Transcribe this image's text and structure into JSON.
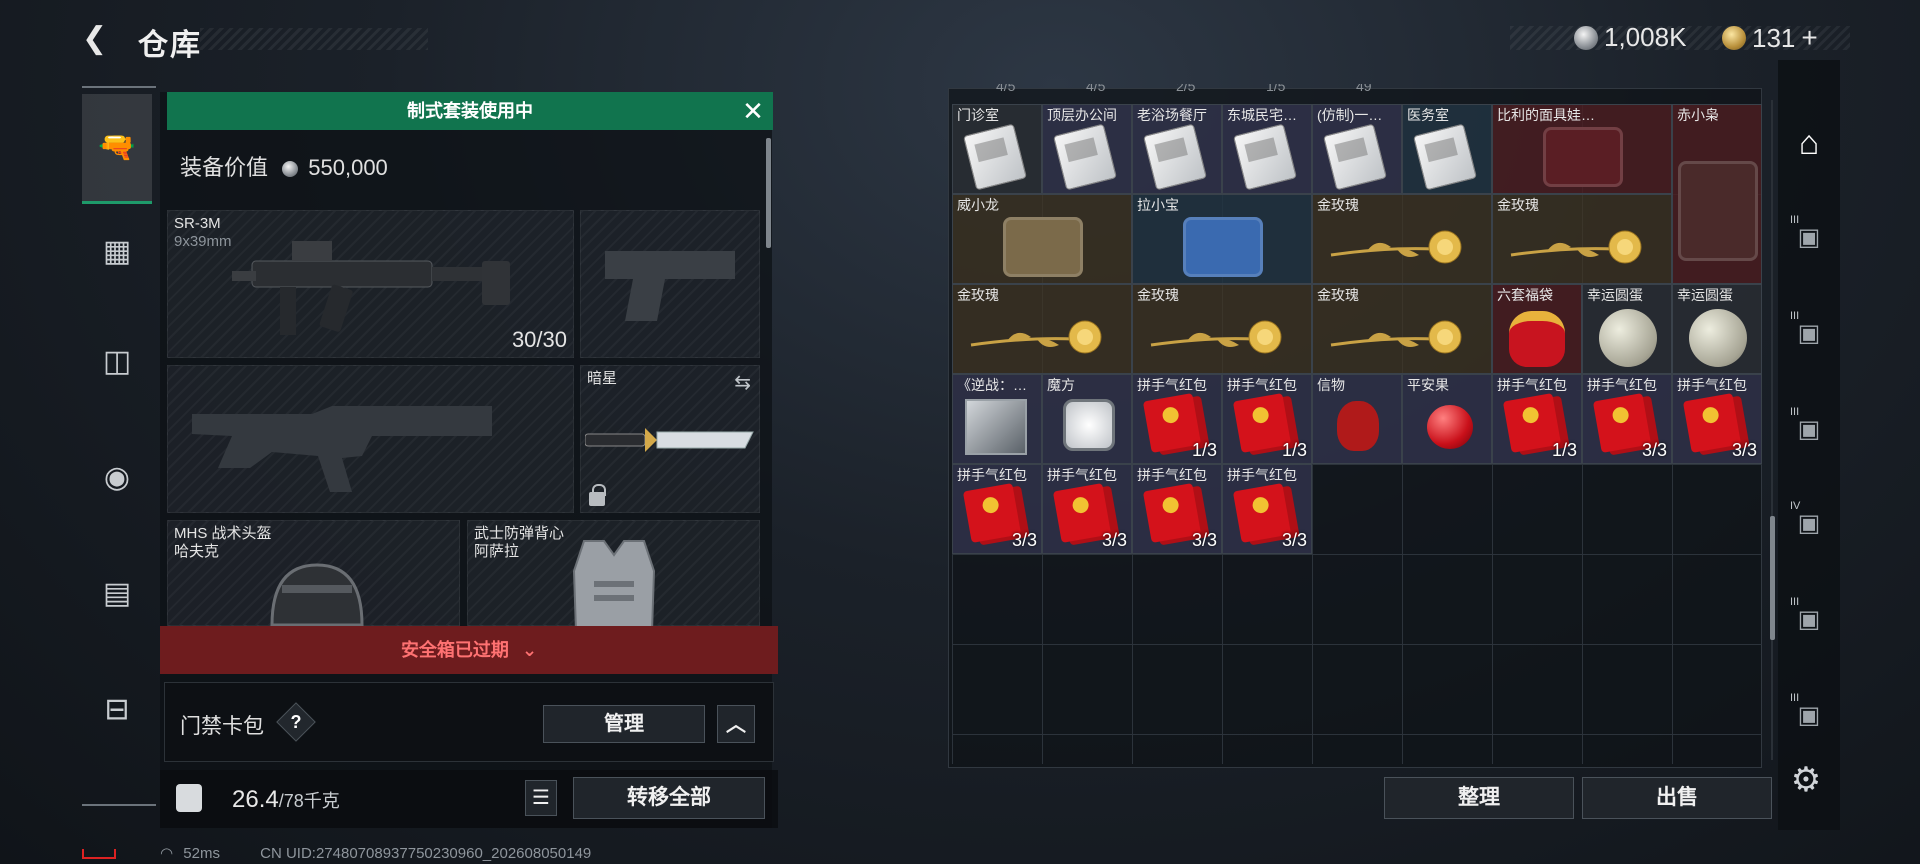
{
  "header": {
    "back_icon": "arrow-left-icon",
    "title": "仓库",
    "currencies": [
      {
        "icon": "silver-coin-icon",
        "value": "1,008K"
      },
      {
        "icon": "gold-coin-icon",
        "value": "131"
      }
    ],
    "add_symbol": "+"
  },
  "left_nav": [
    {
      "icon": "pistol-icon",
      "active": true
    },
    {
      "icon": "armor-vest-icon",
      "active": false
    },
    {
      "icon": "backpack-icon",
      "active": false
    },
    {
      "icon": "helmet-bag-icon",
      "active": false
    },
    {
      "icon": "clipboard-icon",
      "active": false
    },
    {
      "icon": "toolbox-icon",
      "active": false
    }
  ],
  "loadout": {
    "banner": "制式套装使用中",
    "equip_value_label": "装备价值",
    "equip_value": "550,000",
    "primary": {
      "name": "SR-3M",
      "ammo": "9x39mm",
      "count": "30/30"
    },
    "melee": {
      "name": "暗星"
    },
    "helmet": {
      "name": "MHS 战术头盔",
      "sub": "哈夫克"
    },
    "vest": {
      "name": "武士防弹背心",
      "sub": "阿萨拉"
    },
    "safe_box_status": "安全箱已过期",
    "card_pack_label": "门禁卡包",
    "help_symbol": "?",
    "manage_label": "管理",
    "collapse_symbol": "︿",
    "weight_value": "26.4",
    "weight_max": "/78千克",
    "list_icon": "list-icon",
    "transfer_all_label": "转移全部"
  },
  "status": {
    "ping": "52ms",
    "uid": "CN UID:274807089377502309​60_202608050149"
  },
  "stash": {
    "peek_counts": [
      "4/5",
      "4/5",
      "2/5",
      "1/5",
      "49"
    ],
    "items": [
      {
        "name": "门诊室",
        "kind": "keycard",
        "count": ""
      },
      {
        "name": "顶层办公间",
        "kind": "keycard",
        "count": ""
      },
      {
        "name": "老浴场餐厅",
        "kind": "keycard",
        "count": ""
      },
      {
        "name": "东城民宅…",
        "kind": "keycard",
        "count": ""
      },
      {
        "name": "(仿制)一…",
        "kind": "keycard",
        "count": ""
      },
      {
        "name": "医务室",
        "kind": "keycard",
        "count": ""
      },
      {
        "name": "比利的面具娃…",
        "kind": "figure",
        "count": ""
      },
      {
        "name": "赤小枭",
        "kind": "figure",
        "count": ""
      },
      {
        "name": "威小龙",
        "kind": "figure",
        "count": ""
      },
      {
        "name": "拉小宝",
        "kind": "figure",
        "count": ""
      },
      {
        "name": "金玫瑰",
        "kind": "rose",
        "count": ""
      },
      {
        "name": "金玫瑰",
        "kind": "rose",
        "count": ""
      },
      {
        "name": "金玫瑰",
        "kind": "rose",
        "count": ""
      },
      {
        "name": "金玫瑰",
        "kind": "rose",
        "count": ""
      },
      {
        "name": "金玫瑰",
        "kind": "rose",
        "count": ""
      },
      {
        "name": "六套福袋",
        "kind": "bag",
        "count": ""
      },
      {
        "name": "幸运圆蛋",
        "kind": "moon",
        "count": ""
      },
      {
        "name": "幸运圆蛋",
        "kind": "moon",
        "count": ""
      },
      {
        "name": "《逆战：…",
        "kind": "box",
        "count": ""
      },
      {
        "name": "魔方",
        "kind": "cube",
        "count": ""
      },
      {
        "name": "拼手气红包",
        "kind": "envelope",
        "count": "1/3"
      },
      {
        "name": "拼手气红包",
        "kind": "envelope",
        "count": "1/3"
      },
      {
        "name": "信物",
        "kind": "mask",
        "count": ""
      },
      {
        "name": "平安果",
        "kind": "apple",
        "count": ""
      },
      {
        "name": "拼手气红包",
        "kind": "envelope",
        "count": "1/3"
      },
      {
        "name": "拼手气红包",
        "kind": "envelope",
        "count": "3/3"
      },
      {
        "name": "拼手气红包",
        "kind": "envelope",
        "count": "3/3"
      },
      {
        "name": "拼手气红包",
        "kind": "envelope",
        "count": "3/3"
      },
      {
        "name": "拼手气红包",
        "kind": "envelope",
        "count": "3/3"
      },
      {
        "name": "拼手气红包",
        "kind": "envelope",
        "count": "3/3"
      },
      {
        "name": "拼手气红包",
        "kind": "envelope",
        "count": "3/3"
      }
    ],
    "organize_label": "整理",
    "sell_label": "出售"
  },
  "right_tabs": [
    {
      "icon": "stash-icon",
      "roman": "",
      "active": true
    },
    {
      "icon": "storage-case-icon",
      "roman": "III",
      "active": false
    },
    {
      "icon": "storage-case-icon",
      "roman": "III",
      "active": false
    },
    {
      "icon": "storage-case-icon",
      "roman": "III",
      "active": false
    },
    {
      "icon": "storage-case-icon",
      "roman": "IV",
      "active": false
    },
    {
      "icon": "storage-case-icon",
      "roman": "III",
      "active": false
    },
    {
      "icon": "storage-case-icon",
      "roman": "III",
      "active": false
    }
  ],
  "settings_icon": "gear-icon",
  "colors": {
    "accent_green": "#11744e",
    "expired_red": "#6e1c1e"
  }
}
